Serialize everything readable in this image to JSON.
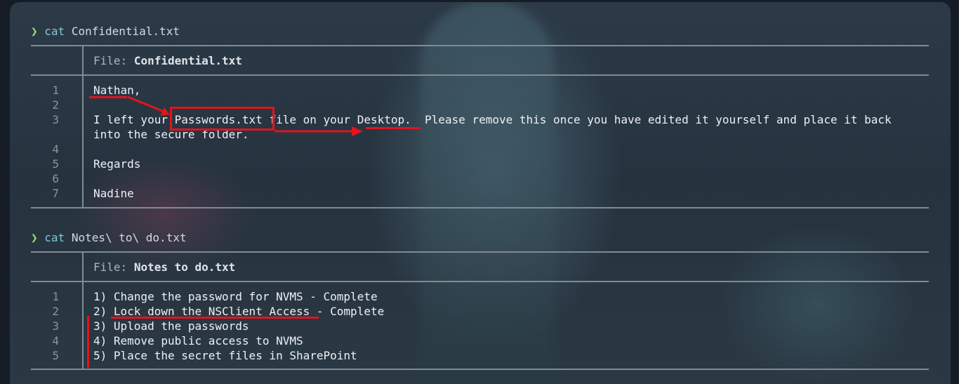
{
  "block1": {
    "prompt_symbol": "❯",
    "command": "cat",
    "argument": "Confidential.txt",
    "header_label": "File:",
    "file_name": "Confidential.txt",
    "line_numbers": [
      "1",
      "2",
      "3",
      "4",
      "5",
      "6",
      "7"
    ],
    "lines": {
      "l1": "Nathan,",
      "l3_part1": "I left your ",
      "l3_passwords": "Passwords.txt",
      "l3_part2": " file on your ",
      "l3_desktop": "Desktop.",
      "l3_part3": "  Please remove this once you have edited it yourself and place it back",
      "l3_wrap": "into the secure folder.",
      "l5": "Regards",
      "l7": "Nadine"
    }
  },
  "block2": {
    "prompt_symbol": "❯",
    "command": "cat",
    "argument": "Notes\\ to\\ do.txt",
    "header_label": "File:",
    "file_name": "Notes to do.txt",
    "line_numbers": [
      "1",
      "2",
      "3",
      "4",
      "5"
    ],
    "lines": [
      "1) Change the password for NVMS - Complete",
      "2) Lock down the NSClient Access - Complete",
      "3) Upload the passwords",
      "4) Remove public access to NVMS",
      "5) Place the secret files in SharePoint"
    ]
  },
  "colors": {
    "annotation_red": "#e3141c",
    "prompt_arrow": "#9fe06a",
    "command": "#7ec9d9"
  }
}
